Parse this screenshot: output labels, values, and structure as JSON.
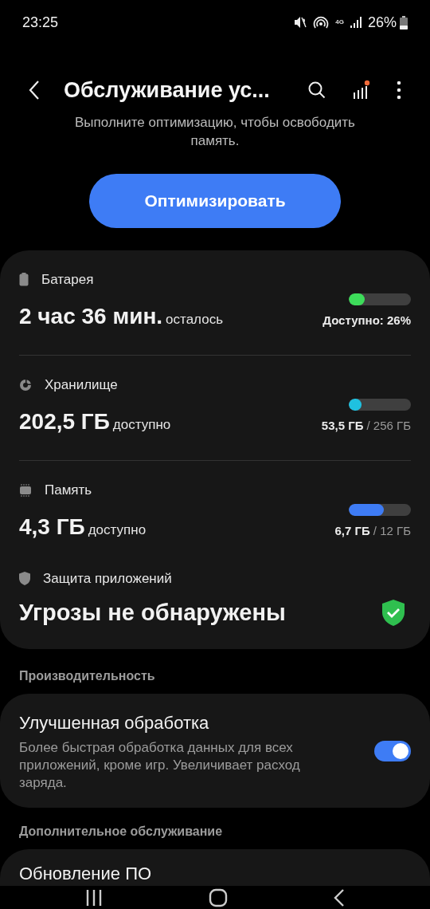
{
  "status_bar": {
    "time": "23:25",
    "network": "4G",
    "battery": "26%"
  },
  "header": {
    "title": "Обслуживание ус...",
    "notification_dot": true
  },
  "intro": {
    "text": "Выполните оптимизацию, чтобы освободить память.",
    "button": "Оптимизировать"
  },
  "metrics": [
    {
      "kind": "battery",
      "label": "Батарея",
      "value": "2 час 36 мин.",
      "suffix": "осталось",
      "level": 0.26,
      "color": "#3ddc5a",
      "reading": "Доступно: 26%"
    },
    {
      "kind": "storage",
      "label": "Хранилище",
      "value": "202,5 ГБ",
      "suffix": "доступно",
      "level": 0.21,
      "color": "#1fc1e0",
      "used": "53,5 ГБ",
      "total": "/ 256 ГБ"
    },
    {
      "kind": "memory",
      "label": "Память",
      "value": "4,3 ГБ",
      "suffix": "доступно",
      "level": 0.56,
      "color": "#3e7cf5",
      "used": "6,7 ГБ",
      "total": "/ 12 ГБ"
    }
  ],
  "protection": {
    "label": "Защита приложений",
    "value": "Угрозы не обнаружены",
    "safe": true
  },
  "performance": {
    "heading": "Производительность",
    "title": "Улучшенная обработка",
    "description": "Более быстрая обработка данных для всех приложений, кроме игр. Увеличивает расход заряда.",
    "on": true
  },
  "additional": {
    "heading": "Дополнительное обслуживание",
    "items": [
      "Обновление ПО"
    ]
  }
}
